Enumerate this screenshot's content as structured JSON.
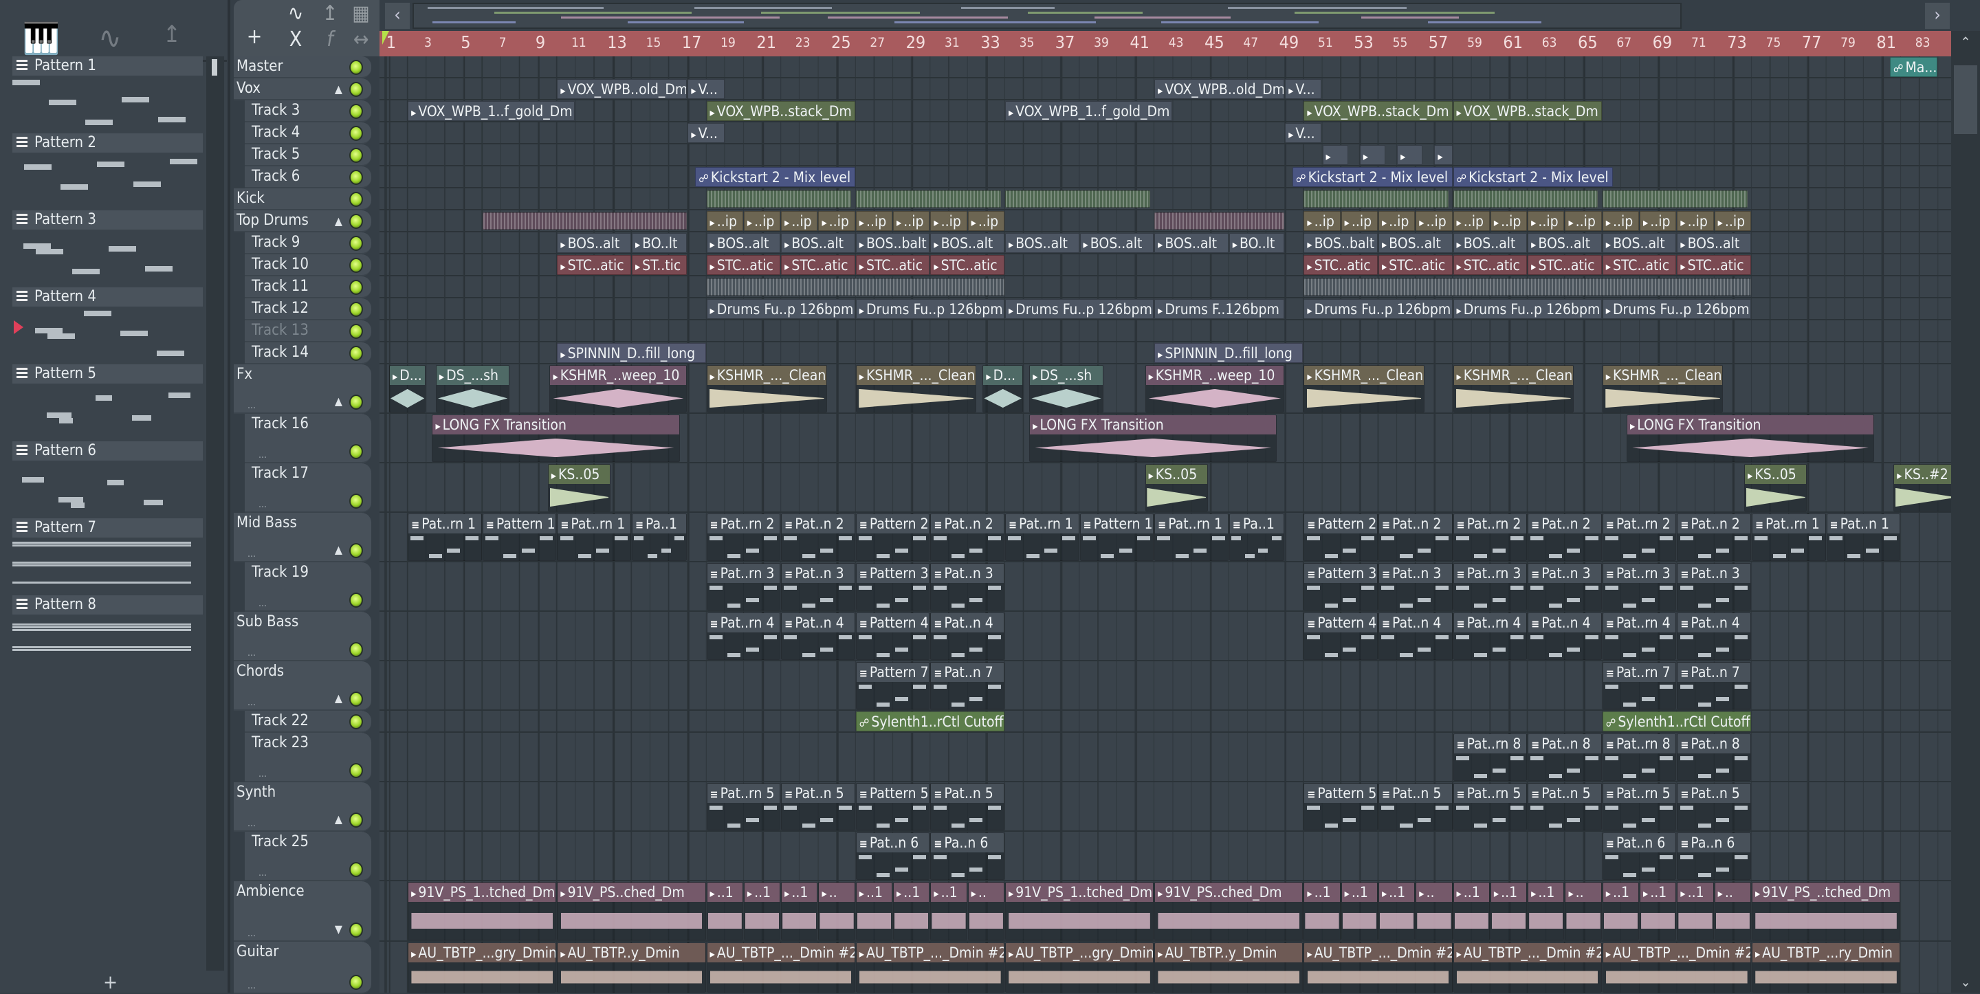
{
  "picker": {
    "tabs": [
      "piano-roll",
      "audio",
      "automation"
    ],
    "patterns": [
      "Pattern 1",
      "Pattern 2",
      "Pattern 3",
      "Pattern 4",
      "Pattern 5",
      "Pattern 6",
      "Pattern 7",
      "Pattern 8"
    ],
    "selected_pattern": "Pattern 4",
    "add_label": "+"
  },
  "toolbar": {
    "add": "+",
    "delete": "X",
    "fx": "f",
    "stretch": "↔",
    "prev": "‹",
    "next": "›"
  },
  "ruler": {
    "labels": [
      1,
      3,
      5,
      7,
      9,
      11,
      13,
      15,
      17,
      19,
      21,
      23,
      25,
      27,
      29,
      31,
      33,
      35,
      37,
      39,
      41,
      43,
      45,
      47,
      49,
      51,
      53,
      55,
      57,
      59,
      61,
      63,
      65,
      67,
      69,
      71,
      73,
      75,
      77,
      79,
      81,
      83
    ]
  },
  "tracks": [
    {
      "name": "Master",
      "sub": false
    },
    {
      "name": "Vox",
      "sub": false,
      "arrow": "▲"
    },
    {
      "name": "Track 3",
      "sub": true
    },
    {
      "name": "Track 4",
      "sub": true
    },
    {
      "name": "Track 5",
      "sub": true
    },
    {
      "name": "Track 6",
      "sub": true
    },
    {
      "name": "Kick",
      "sub": false
    },
    {
      "name": "Top Drums",
      "sub": false,
      "arrow": "▲"
    },
    {
      "name": "Track 9",
      "sub": true
    },
    {
      "name": "Track 10",
      "sub": true
    },
    {
      "name": "Track 11",
      "sub": true
    },
    {
      "name": "Track 12",
      "sub": true
    },
    {
      "name": "Track 13",
      "sub": true,
      "dim": true
    },
    {
      "name": "Track 14",
      "sub": true
    },
    {
      "name": "Fx",
      "sub": false,
      "arrow": "▲"
    },
    {
      "name": "Track 16",
      "sub": true
    },
    {
      "name": "Track 17",
      "sub": true
    },
    {
      "name": "Mid Bass",
      "sub": false,
      "arrow": "▲"
    },
    {
      "name": "Track 19",
      "sub": true
    },
    {
      "name": "Sub Bass",
      "sub": false
    },
    {
      "name": "Chords",
      "sub": false,
      "arrow": "▲"
    },
    {
      "name": "Track 22",
      "sub": true
    },
    {
      "name": "Track 23",
      "sub": true
    },
    {
      "name": "Synth",
      "sub": false,
      "arrow": "▲"
    },
    {
      "name": "Track 25",
      "sub": true
    },
    {
      "name": "Ambience",
      "sub": false,
      "arrow": "▼"
    },
    {
      "name": "Guitar",
      "sub": false
    }
  ],
  "clip_colors": {
    "g": [
      "#4d5663",
      "#b9c2cc"
    ],
    "G": [
      "#5d6f4f",
      "#c5d4b4"
    ],
    "a": [
      "#4b5684",
      "#c0c6e0"
    ],
    "r": [
      "#7a4a52",
      "#d9b0b6"
    ],
    "k": [
      "#6d5468",
      "#d4b3c6"
    ],
    "b": [
      "#6c6552",
      "#d6d0b8"
    ],
    "t": [
      "#4f6a66",
      "#b9d0cc"
    ],
    "m": [
      "#3f8a83",
      "#bfe"
    ],
    "s": [
      "#5c7d4b",
      "#cfe0b8"
    ],
    "y": [
      "#5e4b5a",
      "#6b5566"
    ],
    "x": [
      "#4e6650",
      "#6e8a6a"
    ],
    "z": [
      "#4a535b",
      "#555e66"
    ],
    "v": [
      "#545a70",
      "#c0c4d8"
    ],
    "amb": [
      "#75596a",
      "#d9b9c8"
    ],
    "gtr": [
      "#6e5a55",
      "#dcc4ba"
    ],
    "p": [
      "#48515a",
      "#b8c0c6"
    ]
  },
  "clips": [
    [
      0,
      81.4,
      2.6,
      "Ma...e",
      "m"
    ],
    [
      1,
      10,
      7,
      "VOX_WPB..old_Dm",
      "g"
    ],
    [
      1,
      17,
      2,
      "V...",
      "g"
    ],
    [
      1,
      42,
      7,
      "VOX_WPB..old_Dm",
      "g"
    ],
    [
      1,
      49,
      2,
      "V...",
      "g"
    ],
    [
      2,
      2,
      9,
      "VOX_WPB_1..f_gold_Dm",
      "g"
    ],
    [
      2,
      18,
      8,
      "VOX_WPB..stack_Dm",
      "G"
    ],
    [
      2,
      34,
      9,
      "VOX_WPB_1..f_gold_Dm",
      "g"
    ],
    [
      2,
      50,
      8,
      "VOX_WPB..stack_Dm",
      "G"
    ],
    [
      2,
      58,
      8,
      "VOX_WPB..stack_Dm",
      "G"
    ],
    [
      3,
      17,
      2,
      "V...",
      "g"
    ],
    [
      3,
      49,
      2,
      "V...",
      "g"
    ],
    [
      4,
      51,
      1.4,
      "",
      "g"
    ],
    [
      4,
      53,
      1.4,
      "",
      "g"
    ],
    [
      4,
      55,
      1.4,
      "",
      "g"
    ],
    [
      4,
      57,
      1,
      "",
      "g"
    ],
    [
      5,
      17.4,
      8.6,
      "Kickstart 2 - Mix level",
      "a"
    ],
    [
      5,
      49.4,
      8.6,
      "Kickstart 2 - Mix level",
      "a"
    ],
    [
      5,
      58,
      8.6,
      "Kickstart 2 - Mix level",
      "a"
    ],
    [
      6,
      18,
      7.8,
      "",
      "x"
    ],
    [
      6,
      26,
      7.8,
      "",
      "x"
    ],
    [
      6,
      34,
      7.8,
      "",
      "x"
    ],
    [
      6,
      50,
      7.8,
      "",
      "x"
    ],
    [
      6,
      58,
      7.8,
      "",
      "x"
    ],
    [
      6,
      66,
      7.8,
      "",
      "x"
    ],
    [
      7,
      6,
      11,
      "",
      "y"
    ],
    [
      7,
      42,
      7,
      "",
      "y"
    ],
    [
      7,
      18,
      2,
      "..ip",
      "b"
    ],
    [
      7,
      20,
      2,
      "..ip",
      "b"
    ],
    [
      7,
      22,
      2,
      "..ip",
      "b"
    ],
    [
      7,
      24,
      2,
      "..ip",
      "b"
    ],
    [
      7,
      26,
      2,
      "..ip",
      "b"
    ],
    [
      7,
      28,
      2,
      "..ip",
      "b"
    ],
    [
      7,
      30,
      2,
      "..ip",
      "b"
    ],
    [
      7,
      32,
      2,
      "..ip",
      "b"
    ],
    [
      7,
      50,
      2,
      "..ip",
      "b"
    ],
    [
      7,
      52,
      2,
      "..ip",
      "b"
    ],
    [
      7,
      54,
      2,
      "..ip",
      "b"
    ],
    [
      7,
      56,
      2,
      "..ip",
      "b"
    ],
    [
      7,
      58,
      2,
      "..ip",
      "b"
    ],
    [
      7,
      60,
      2,
      "..ip",
      "b"
    ],
    [
      7,
      62,
      2,
      "..ip",
      "b"
    ],
    [
      7,
      64,
      2,
      "..ip",
      "b"
    ],
    [
      7,
      66,
      2,
      "..ip",
      "b"
    ],
    [
      7,
      68,
      2,
      "..ip",
      "b"
    ],
    [
      7,
      70,
      2,
      "..ip",
      "b"
    ],
    [
      7,
      72,
      2,
      "..ip",
      "b"
    ],
    [
      8,
      10,
      4,
      "BOS..alt",
      "g"
    ],
    [
      8,
      14,
      3,
      "BO..lt",
      "g"
    ],
    [
      8,
      18,
      4,
      "BOS..alt",
      "g"
    ],
    [
      8,
      22,
      4,
      "BOS..alt",
      "g"
    ],
    [
      8,
      26,
      4,
      "BOS..balt",
      "g"
    ],
    [
      8,
      30,
      4,
      "BOS..alt",
      "g"
    ],
    [
      8,
      34,
      4,
      "BOS..alt",
      "g"
    ],
    [
      8,
      38,
      4,
      "BOS..alt",
      "g"
    ],
    [
      8,
      42,
      4,
      "BOS..alt",
      "g"
    ],
    [
      8,
      46,
      3,
      "BO..lt",
      "g"
    ],
    [
      8,
      50,
      4,
      "BOS..balt",
      "g"
    ],
    [
      8,
      54,
      4,
      "BOS..alt",
      "g"
    ],
    [
      8,
      58,
      4,
      "BOS..alt",
      "g"
    ],
    [
      8,
      62,
      4,
      "BOS..alt",
      "g"
    ],
    [
      8,
      66,
      4,
      "BOS..alt",
      "g"
    ],
    [
      8,
      70,
      4,
      "BOS..alt",
      "g"
    ],
    [
      9,
      10,
      4,
      "STC..atic",
      "r"
    ],
    [
      9,
      14,
      3,
      "ST..tic",
      "r"
    ],
    [
      9,
      18,
      4,
      "STC..atic",
      "r"
    ],
    [
      9,
      22,
      4,
      "STC..atic",
      "r"
    ],
    [
      9,
      26,
      4,
      "STC..atic",
      "r"
    ],
    [
      9,
      30,
      4,
      "STC..atic",
      "r"
    ],
    [
      9,
      50,
      4,
      "STC..atic",
      "r"
    ],
    [
      9,
      54,
      4,
      "STC..atic",
      "r"
    ],
    [
      9,
      58,
      4,
      "STC..atic",
      "r"
    ],
    [
      9,
      62,
      4,
      "STC..atic",
      "r"
    ],
    [
      9,
      66,
      4,
      "STC..atic",
      "r"
    ],
    [
      9,
      70,
      4,
      "STC..atic",
      "r"
    ],
    [
      10,
      18,
      16,
      "",
      "z"
    ],
    [
      10,
      50,
      24,
      "",
      "z"
    ],
    [
      11,
      18,
      8,
      "Drums Fu..p 126bpm",
      "g"
    ],
    [
      11,
      26,
      8,
      "Drums Fu..p 126bpm",
      "g"
    ],
    [
      11,
      34,
      8,
      "Drums Fu..p 126bpm",
      "g"
    ],
    [
      11,
      42,
      7,
      "Drums F..126bpm",
      "g"
    ],
    [
      11,
      50,
      8,
      "Drums Fu..p 126bpm",
      "g"
    ],
    [
      11,
      58,
      8,
      "Drums Fu..p 126bpm",
      "g"
    ],
    [
      11,
      66,
      8,
      "Drums Fu..p 126bpm",
      "g"
    ],
    [
      13,
      10,
      8,
      "SPINNIN_D..fill_long",
      "v"
    ],
    [
      13,
      42,
      8,
      "SPINNIN_D..fill_long",
      "v"
    ],
    [
      14,
      1,
      2,
      "D...",
      "t"
    ],
    [
      14,
      3.5,
      4,
      "DS_...sh",
      "t"
    ],
    [
      14,
      9.6,
      7.4,
      "KSHMR_..weep_10",
      "k"
    ],
    [
      14,
      18,
      6.5,
      "KSHMR_..._Clean",
      "b"
    ],
    [
      14,
      26,
      6.5,
      "KSHMR_..._Clean",
      "b"
    ],
    [
      14,
      32.8,
      2.2,
      "D...",
      "t"
    ],
    [
      14,
      35.3,
      4,
      "DS_...sh",
      "t"
    ],
    [
      14,
      41.5,
      7.5,
      "KSHMR_..weep_10",
      "k"
    ],
    [
      14,
      50,
      6.5,
      "KSHMR_..._Clean",
      "b"
    ],
    [
      14,
      58,
      6.5,
      "KSHMR_..._Clean",
      "b"
    ],
    [
      14,
      66,
      6.5,
      "KSHMR_..._Clean",
      "b"
    ],
    [
      15,
      3.3,
      13.3,
      "LONG FX Transition",
      "k"
    ],
    [
      15,
      35.3,
      13.3,
      "LONG FX Transition",
      "k"
    ],
    [
      15,
      67.3,
      13.3,
      "LONG FX Transition",
      "k"
    ],
    [
      16,
      9.5,
      3.4,
      "KS..05",
      "G"
    ],
    [
      16,
      41.5,
      3.4,
      "KS..05",
      "G"
    ],
    [
      16,
      73.6,
      3.4,
      "KS..05",
      "G"
    ],
    [
      16,
      81.6,
      3.4,
      "KS..#2",
      "G"
    ],
    [
      17,
      2,
      4,
      "Pat..rn 1",
      "p"
    ],
    [
      17,
      6,
      4,
      "Pattern 1",
      "p"
    ],
    [
      17,
      10,
      4,
      "Pat..rn 1",
      "p"
    ],
    [
      17,
      14,
      3,
      "Pa..1",
      "p"
    ],
    [
      17,
      18,
      4,
      "Pat..rn 2",
      "p"
    ],
    [
      17,
      22,
      4,
      "Pat..n 2",
      "p"
    ],
    [
      17,
      26,
      4,
      "Pattern 2",
      "p"
    ],
    [
      17,
      30,
      4,
      "Pat..n 2",
      "p"
    ],
    [
      17,
      34,
      4,
      "Pat..rn 1",
      "p"
    ],
    [
      17,
      38,
      4,
      "Pattern 1",
      "p"
    ],
    [
      17,
      42,
      4,
      "Pat..rn 1",
      "p"
    ],
    [
      17,
      46,
      3,
      "Pa..1",
      "p"
    ],
    [
      17,
      50,
      4,
      "Pattern 2",
      "p"
    ],
    [
      17,
      54,
      4,
      "Pat..n 2",
      "p"
    ],
    [
      17,
      58,
      4,
      "Pat..rn 2",
      "p"
    ],
    [
      17,
      62,
      4,
      "Pat..n 2",
      "p"
    ],
    [
      17,
      66,
      4,
      "Pat..rn 2",
      "p"
    ],
    [
      17,
      70,
      4,
      "Pat..n 2",
      "p"
    ],
    [
      17,
      74,
      4,
      "Pat..rn 1",
      "p"
    ],
    [
      17,
      78,
      4,
      "Pat..n 1",
      "p"
    ],
    [
      18,
      18,
      4,
      "Pat..rn 3",
      "p"
    ],
    [
      18,
      22,
      4,
      "Pat..n 3",
      "p"
    ],
    [
      18,
      26,
      4,
      "Pattern 3",
      "p"
    ],
    [
      18,
      30,
      4,
      "Pat..n 3",
      "p"
    ],
    [
      18,
      50,
      4,
      "Pattern 3",
      "p"
    ],
    [
      18,
      54,
      4,
      "Pat..n 3",
      "p"
    ],
    [
      18,
      58,
      4,
      "Pat..rn 3",
      "p"
    ],
    [
      18,
      62,
      4,
      "Pat..n 3",
      "p"
    ],
    [
      18,
      66,
      4,
      "Pat..rn 3",
      "p"
    ],
    [
      18,
      70,
      4,
      "Pat..n 3",
      "p"
    ],
    [
      19,
      18,
      4,
      "Pat..rn 4",
      "p"
    ],
    [
      19,
      22,
      4,
      "Pat..n 4",
      "p"
    ],
    [
      19,
      26,
      4,
      "Pattern 4",
      "p"
    ],
    [
      19,
      30,
      4,
      "Pat..n 4",
      "p"
    ],
    [
      19,
      50,
      4,
      "Pattern 4",
      "p"
    ],
    [
      19,
      54,
      4,
      "Pat..n 4",
      "p"
    ],
    [
      19,
      58,
      4,
      "Pat..rn 4",
      "p"
    ],
    [
      19,
      62,
      4,
      "Pat..n 4",
      "p"
    ],
    [
      19,
      66,
      4,
      "Pat..rn 4",
      "p"
    ],
    [
      19,
      70,
      4,
      "Pat..n 4",
      "p"
    ],
    [
      20,
      26,
      4,
      "Pattern 7",
      "p"
    ],
    [
      20,
      30,
      4,
      "Pat..n 7",
      "p"
    ],
    [
      20,
      66,
      4,
      "Pat..rn 7",
      "p"
    ],
    [
      20,
      70,
      4,
      "Pat..n 7",
      "p"
    ],
    [
      21,
      26,
      8,
      "Sylenth1..rCtl Cutoff",
      "s"
    ],
    [
      21,
      66,
      8,
      "Sylenth1..rCtl Cutoff",
      "s"
    ],
    [
      22,
      58,
      4,
      "Pat..rn 8",
      "p"
    ],
    [
      22,
      62,
      4,
      "Pat..n 8",
      "p"
    ],
    [
      22,
      66,
      4,
      "Pat..rn 8",
      "p"
    ],
    [
      22,
      70,
      4,
      "Pat..n 8",
      "p"
    ],
    [
      23,
      18,
      4,
      "Pat..rn 5",
      "p"
    ],
    [
      23,
      22,
      4,
      "Pat..n 5",
      "p"
    ],
    [
      23,
      26,
      4,
      "Pattern 5",
      "p"
    ],
    [
      23,
      30,
      4,
      "Pat..n 5",
      "p"
    ],
    [
      23,
      50,
      4,
      "Pattern 5",
      "p"
    ],
    [
      23,
      54,
      4,
      "Pat..n 5",
      "p"
    ],
    [
      23,
      58,
      4,
      "Pat..rn 5",
      "p"
    ],
    [
      23,
      62,
      4,
      "Pat..n 5",
      "p"
    ],
    [
      23,
      66,
      4,
      "Pat..rn 5",
      "p"
    ],
    [
      23,
      70,
      4,
      "Pat..n 5",
      "p"
    ],
    [
      24,
      26,
      4,
      "Pat..n 6",
      "p"
    ],
    [
      24,
      30,
      4,
      "Pa..n 6",
      "p"
    ],
    [
      24,
      66,
      4,
      "Pat..n 6",
      "p"
    ],
    [
      24,
      70,
      4,
      "Pa..n 6",
      "p"
    ],
    [
      25,
      2,
      8,
      "91V_PS_1..tched_Dm",
      "amb"
    ],
    [
      25,
      10,
      8,
      "91V_PS..ched_Dm",
      "amb"
    ],
    [
      25,
      18,
      2,
      "..1",
      "amb"
    ],
    [
      25,
      20,
      2,
      "..1",
      "amb"
    ],
    [
      25,
      22,
      2,
      "..1",
      "amb"
    ],
    [
      25,
      24,
      2,
      "..",
      "amb"
    ],
    [
      25,
      26,
      2,
      "..1",
      "amb"
    ],
    [
      25,
      28,
      2,
      "..1",
      "amb"
    ],
    [
      25,
      30,
      2,
      "..1",
      "amb"
    ],
    [
      25,
      32,
      2,
      "..",
      "amb"
    ],
    [
      25,
      34,
      8,
      "91V_PS_1..tched_Dm",
      "amb"
    ],
    [
      25,
      42,
      8,
      "91V_PS..ched_Dm",
      "amb"
    ],
    [
      25,
      50,
      2,
      "..1",
      "amb"
    ],
    [
      25,
      52,
      2,
      "..1",
      "amb"
    ],
    [
      25,
      54,
      2,
      "..1",
      "amb"
    ],
    [
      25,
      56,
      2,
      "..",
      "amb"
    ],
    [
      25,
      58,
      2,
      "..1",
      "amb"
    ],
    [
      25,
      60,
      2,
      "..1",
      "amb"
    ],
    [
      25,
      62,
      2,
      "..1",
      "amb"
    ],
    [
      25,
      64,
      2,
      "..",
      "amb"
    ],
    [
      25,
      66,
      2,
      "..1",
      "amb"
    ],
    [
      25,
      68,
      2,
      "..1",
      "amb"
    ],
    [
      25,
      70,
      2,
      "..1",
      "amb"
    ],
    [
      25,
      72,
      2,
      "..",
      "amb"
    ],
    [
      25,
      74,
      8,
      "91V_PS_..tched_Dm",
      "amb"
    ],
    [
      26,
      2,
      8,
      "AU_TBTP_...gry_Dmin",
      "gtr"
    ],
    [
      26,
      10,
      8,
      "AU_TBTP..y_Dmin",
      "gtr"
    ],
    [
      26,
      18,
      8,
      "AU_TBTP_..._Dmin #2",
      "gtr"
    ],
    [
      26,
      26,
      8,
      "AU_TBTP_..._Dmin #2",
      "gtr"
    ],
    [
      26,
      34,
      8,
      "AU_TBTP_...gry_Dmin",
      "gtr"
    ],
    [
      26,
      42,
      8,
      "AU_TBTP..y_Dmin",
      "gtr"
    ],
    [
      26,
      50,
      8,
      "AU_TBTP_..._Dmin #2",
      "gtr"
    ],
    [
      26,
      58,
      8,
      "AU_TBTP_..._Dmin #2",
      "gtr"
    ],
    [
      26,
      66,
      8,
      "AU_TBTP_..._Dmin #2",
      "gtr"
    ],
    [
      26,
      74,
      8,
      "AU_TBTP_...ry_Dmin",
      "gtr"
    ]
  ]
}
